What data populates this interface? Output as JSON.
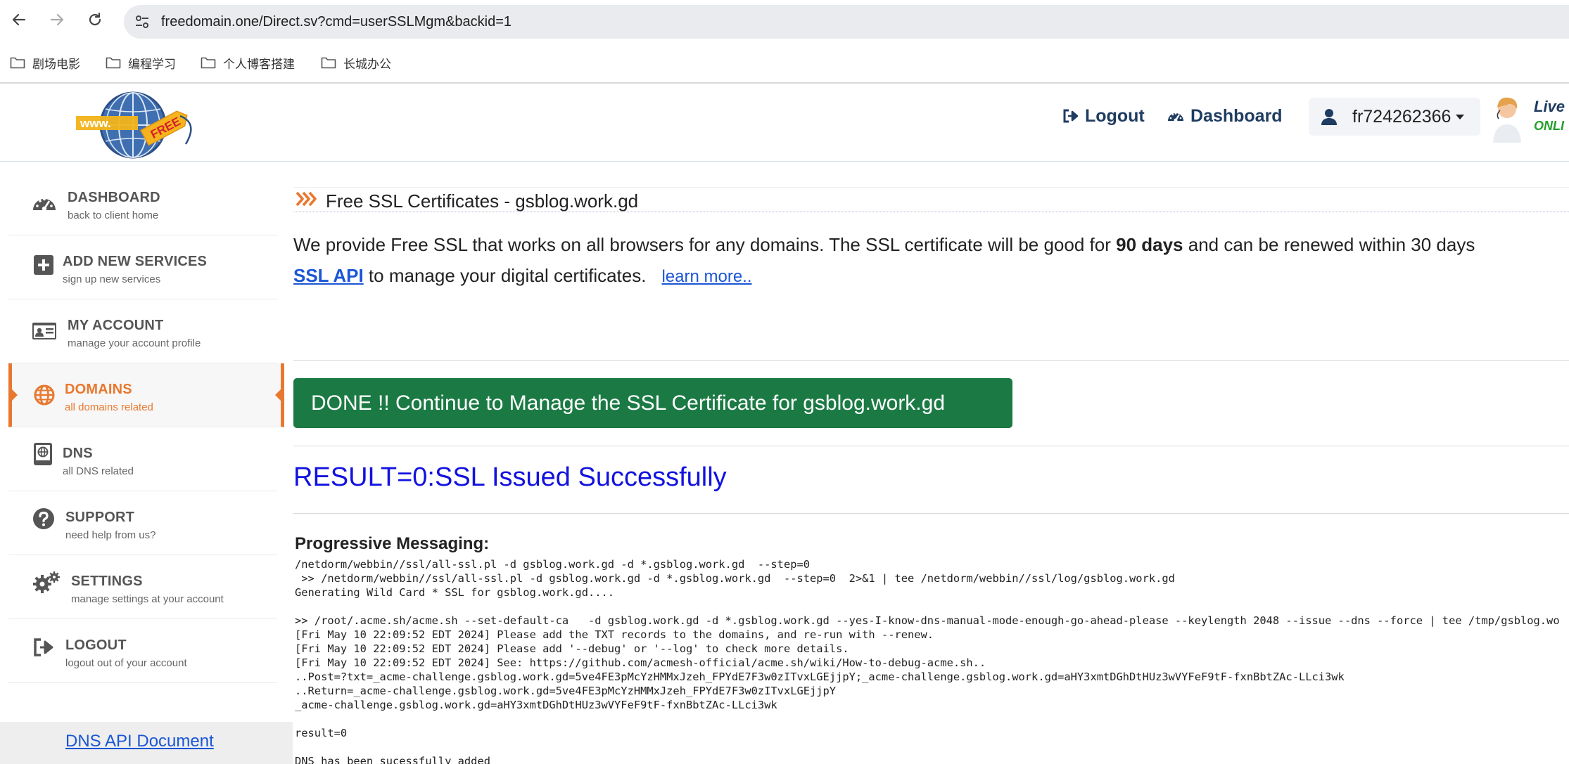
{
  "browser": {
    "url": "freedomain.one/Direct.sv?cmd=userSSLMgm&backid=1",
    "bookmarks": [
      "剧场电影",
      "编程学习",
      "个人博客搭建",
      "长城办公"
    ]
  },
  "header": {
    "logo_text": "www. FREE",
    "logout_label": "Logout",
    "dashboard_label": "Dashboard",
    "username": "fr724262366",
    "live_chat_line1": "Live",
    "live_chat_line2": "ONLI"
  },
  "sidebar": {
    "items": [
      {
        "title": "DASHBOARD",
        "sub": "back to client home",
        "icon": "dashboard-gauge-icon"
      },
      {
        "title": "ADD NEW SERVICES",
        "sub": "sign up new services",
        "icon": "plus-square-icon"
      },
      {
        "title": "MY ACCOUNT",
        "sub": "manage your account profile",
        "icon": "id-card-icon"
      },
      {
        "title": "DOMAINS",
        "sub": "all domains related",
        "icon": "globe-icon"
      },
      {
        "title": "DNS",
        "sub": "all DNS related",
        "icon": "dns-book-icon"
      },
      {
        "title": "SUPPORT",
        "sub": "need help from us?",
        "icon": "question-circle-icon"
      },
      {
        "title": "SETTINGS",
        "sub": "manage settings at your account",
        "icon": "gears-icon"
      },
      {
        "title": "LOGOUT",
        "sub": "logout out of your account",
        "icon": "sign-out-icon"
      }
    ],
    "footer_link": "DNS API Document"
  },
  "main": {
    "section_title": "Free SSL Certificates - gsblog.work.gd",
    "intro_part1": "We provide Free SSL that works on all browsers for any domains. The SSL certificate will be good for ",
    "intro_bold": "90 days",
    "intro_part2": " and can be renewed within 30 days",
    "api_link": "SSL API",
    "intro_part3": " to manage your digital certificates.",
    "learn_more": "learn more..",
    "done_button": "DONE !! Continue to Manage the SSL Certificate for gsblog.work.gd",
    "result_text": "RESULT=0:SSL Issued Successfully",
    "progress_title": "Progressive Messaging:",
    "log_lines": [
      "/netdorm/webbin//ssl/all-ssl.pl -d gsblog.work.gd -d *.gsblog.work.gd  --step=0",
      " >> /netdorm/webbin//ssl/all-ssl.pl -d gsblog.work.gd -d *.gsblog.work.gd  --step=0  2>&1 | tee /netdorm/webbin//ssl/log/gsblog.work.gd",
      "Generating Wild Card * SSL for gsblog.work.gd....",
      "",
      ">> /root/.acme.sh/acme.sh --set-default-ca   -d gsblog.work.gd -d *.gsblog.work.gd --yes-I-know-dns-manual-mode-enough-go-ahead-please --keylength 2048 --issue --dns --force | tee /tmp/gsblog.wo",
      "[Fri May 10 22:09:52 EDT 2024] Please add the TXT records to the domains, and re-run with --renew.",
      "[Fri May 10 22:09:52 EDT 2024] Please add '--debug' or '--log' to check more details.",
      "[Fri May 10 22:09:52 EDT 2024] See: https://github.com/acmesh-official/acme.sh/wiki/How-to-debug-acme.sh..",
      "..Post=?txt=_acme-challenge.gsblog.work.gd=5ve4FE3pMcYzHMMxJzeh_FPYdE7F3w0zITvxLGEjjpY;_acme-challenge.gsblog.work.gd=aHY3xmtDGhDtHUz3wVYFeF9tF-fxnBbtZAc-LLci3wk",
      "..Return=_acme-challenge.gsblog.work.gd=5ve4FE3pMcYzHMMxJzeh_FPYdE7F3w0zITvxLGEjjpY",
      "_acme-challenge.gsblog.work.gd=aHY3xmtDGhDtHUz3wVYFeF9tF-fxnBbtZAc-LLci3wk",
      "",
      "result=0",
      "",
      "DNS has been sucessfully added"
    ]
  },
  "colors": {
    "accent_orange": "#e8782f",
    "done_green": "#1b7a44",
    "result_blue": "#1212e0",
    "link_blue": "#1a56d6",
    "header_navy": "#1f3c61"
  }
}
